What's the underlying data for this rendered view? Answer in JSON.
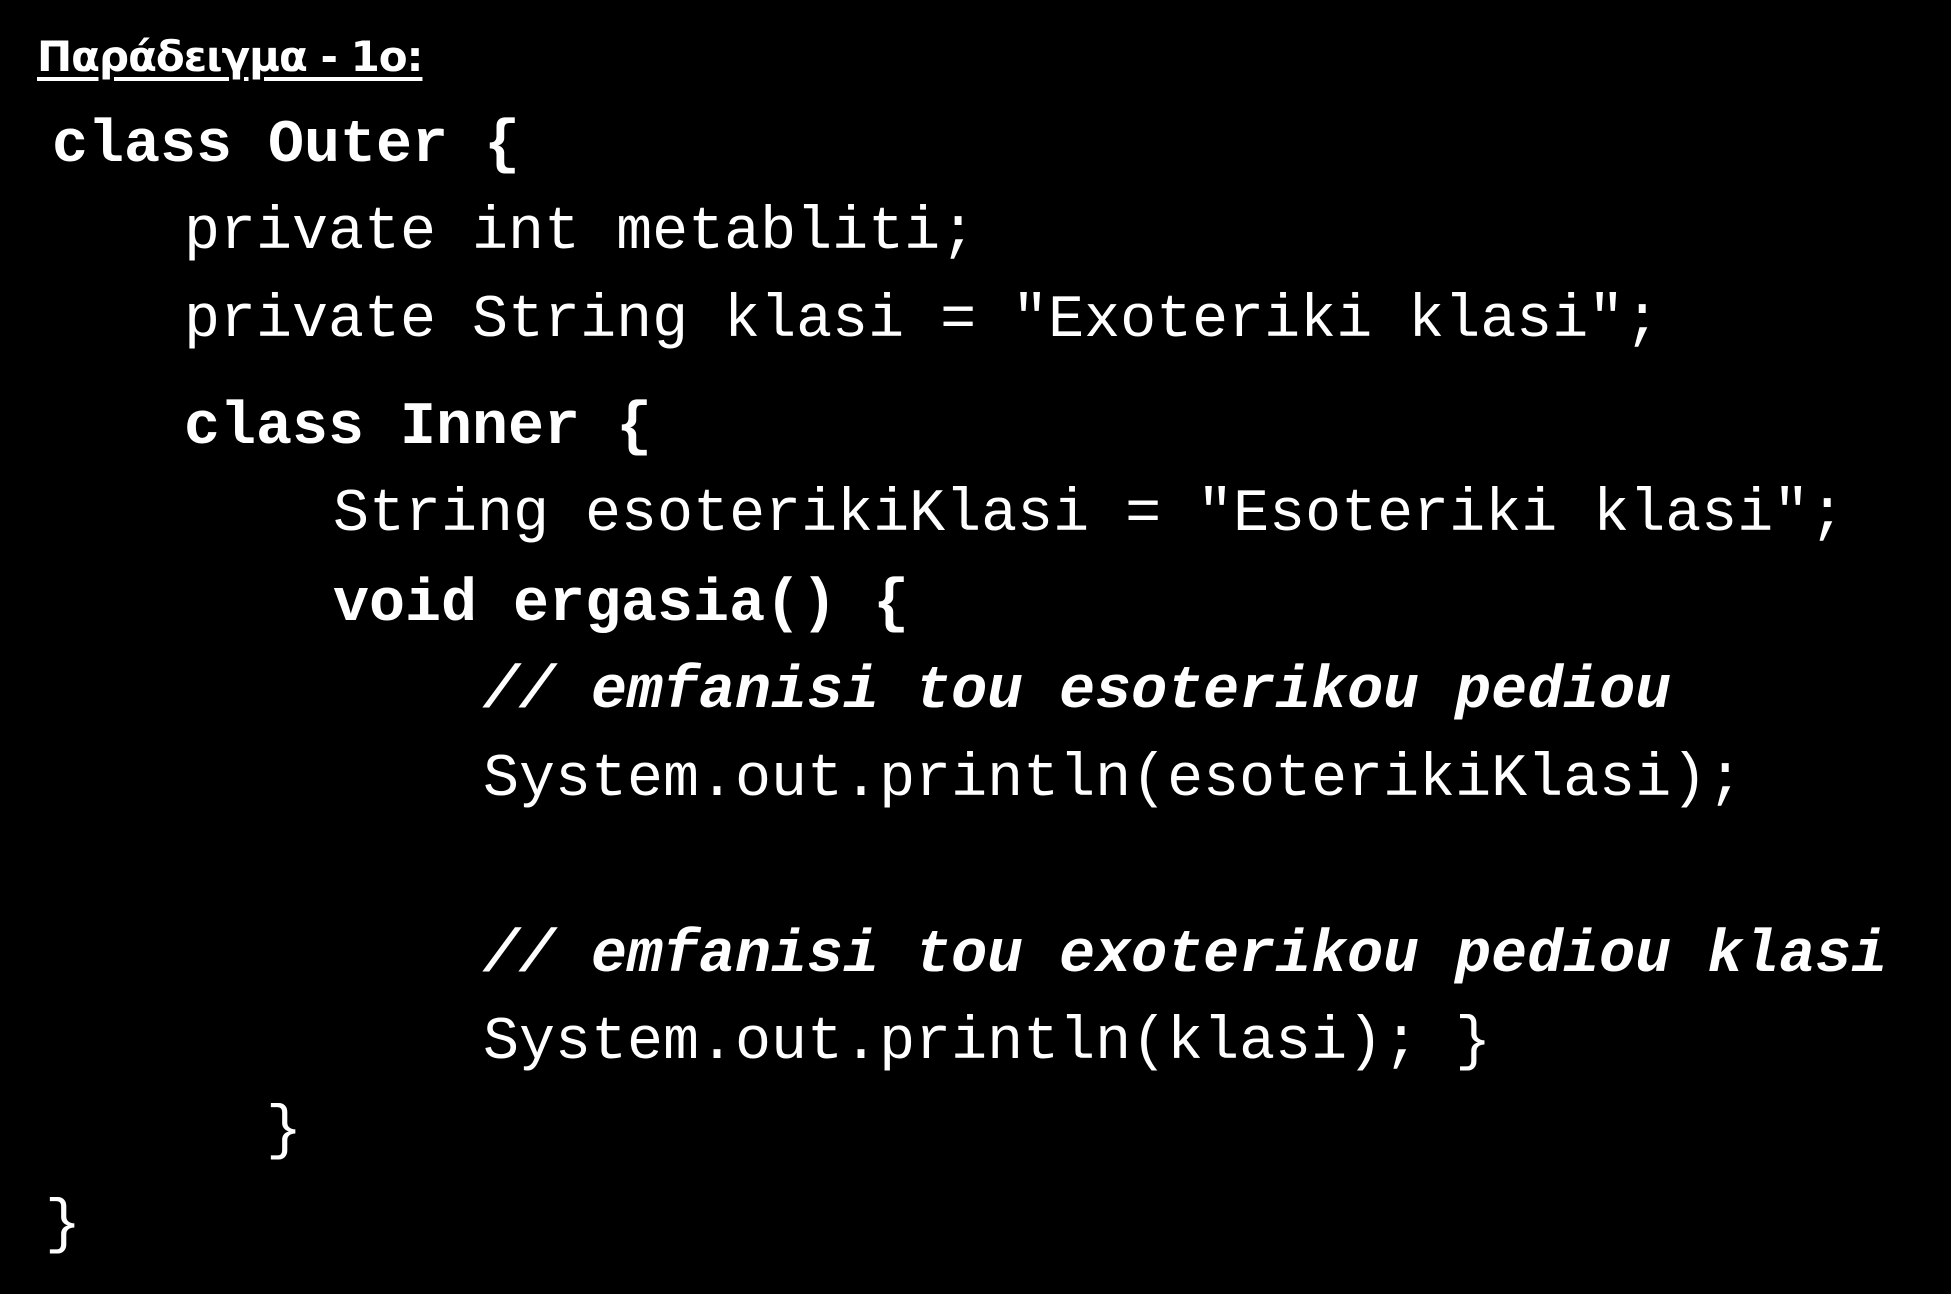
{
  "slide": {
    "title": "Παράδειγμα - 1ο:",
    "code": {
      "l01": "class Outer {",
      "l02": "private int metabliti;",
      "l03": "private String klasi = \"Exoteriki klasi\";",
      "l04": "class Inner {",
      "l05": "String esoterikiKlasi = \"Esoteriki klasi\";",
      "l06": "void ergasia() {",
      "l07": "// emfanisi tou esoterikou pediou",
      "l08": "System.out.println(esoterikiKlasi);",
      "l09": "// emfanisi tou exoterikou pediou klasi",
      "l10": "System.out.println(klasi); }",
      "l11": "}",
      "l12": "}"
    },
    "colors": {
      "background": "#000000",
      "text": "#ffffff"
    }
  }
}
